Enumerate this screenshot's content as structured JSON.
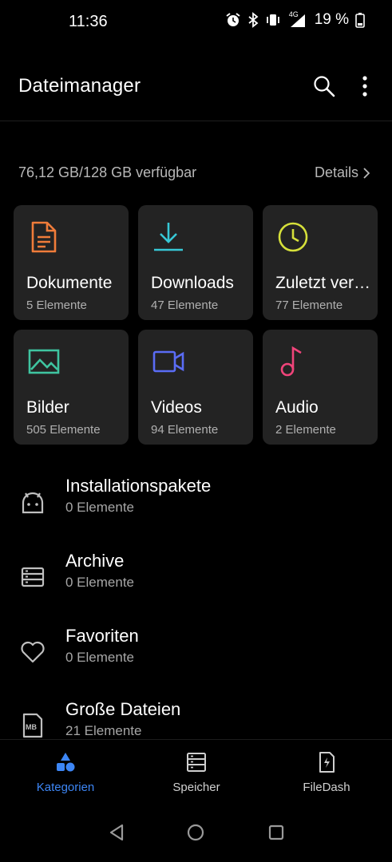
{
  "status": {
    "time": "11:36",
    "network": "4G",
    "battery": "19 %"
  },
  "header": {
    "title": "Dateimanager"
  },
  "storage": {
    "summary": "76,12 GB/128 GB verfügbar",
    "details_label": "Details"
  },
  "tiles": [
    {
      "name": "Dokumente",
      "count": "5 Elemente",
      "icon": "document-icon",
      "color": "#f07c3a"
    },
    {
      "name": "Downloads",
      "count": "47 Elemente",
      "icon": "download-icon",
      "color": "#37c8d6"
    },
    {
      "name": "Zuletzt verwendet",
      "count": "77 Elemente",
      "icon": "clock-icon",
      "color": "#d6e03a"
    },
    {
      "name": "Bilder",
      "count": "505 Elemente",
      "icon": "image-icon",
      "color": "#3fc4a0"
    },
    {
      "name": "Videos",
      "count": "94 Elemente",
      "icon": "video-icon",
      "color": "#5a6cf5"
    },
    {
      "name": "Audio",
      "count": "2 Elemente",
      "icon": "music-note-icon",
      "color": "#f0447a"
    }
  ],
  "list": [
    {
      "name": "Installationspakete",
      "count": "0 Elemente",
      "icon": "android-icon"
    },
    {
      "name": "Archive",
      "count": "0 Elemente",
      "icon": "archive-icon"
    },
    {
      "name": "Favoriten",
      "count": "0 Elemente",
      "icon": "heart-icon"
    },
    {
      "name": "Große Dateien",
      "count": "21 Elemente",
      "icon": "mb-file-icon",
      "icon_text": "MB"
    }
  ],
  "nav": {
    "items": [
      {
        "label": "Kategorien",
        "active": true,
        "icon": "categories-icon"
      },
      {
        "label": "Speicher",
        "active": false,
        "icon": "storage-icon"
      },
      {
        "label": "FileDash",
        "active": false,
        "icon": "filedash-icon"
      }
    ],
    "accent": "#3d86f5"
  }
}
